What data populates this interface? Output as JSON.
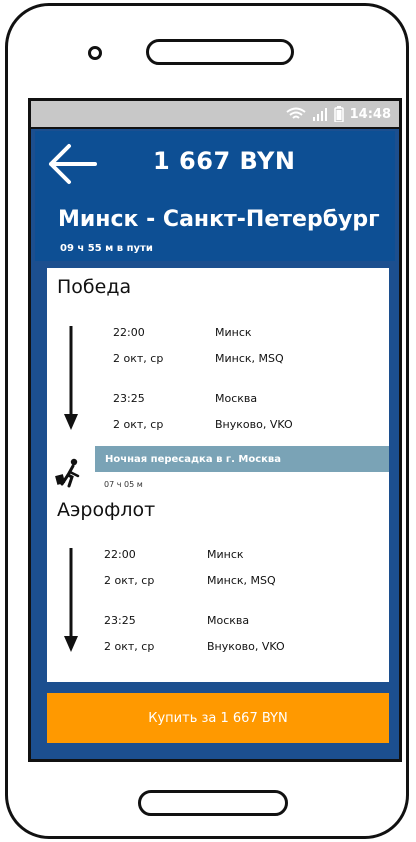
{
  "status_bar": {
    "time": "14:48",
    "icons": [
      "wifi-icon",
      "signal-icon",
      "battery-icon"
    ]
  },
  "header": {
    "price": "1 667 BYN",
    "route": "Минск - Санкт-Петербург",
    "duration": "09 ч 55 м в пути"
  },
  "segments": [
    {
      "airline": "Победа",
      "departure_time": "22:00",
      "departure_date": "2 окт, ср",
      "departure_city": "Минск",
      "departure_airport": "Минск, MSQ",
      "arrival_time": "23:25",
      "arrival_date": "2 окт, ср",
      "arrival_city": "Москва",
      "arrival_airport": "Внуково, VKO"
    },
    {
      "airline": "Аэрофлот",
      "departure_time": "22:00",
      "departure_date": "2 окт, ср",
      "departure_city": "Минск",
      "departure_airport": "Минск, MSQ",
      "arrival_time": "23:25",
      "arrival_date": "2 окт, ср",
      "arrival_city": "Москва",
      "arrival_airport": "Внуково, VKO"
    }
  ],
  "layover": {
    "text": "Ночная пересадка в г. Москва",
    "duration": "07 ч 05 м"
  },
  "buy_button": {
    "label": "Купить за 1 667 BYN"
  },
  "colors": {
    "app_bar": "#0d4f94",
    "screen_bg": "#1c4f8f",
    "layover_bar": "#7aa3b6",
    "buy_button": "#ff9900",
    "status_bar": "#c8c8c8"
  }
}
